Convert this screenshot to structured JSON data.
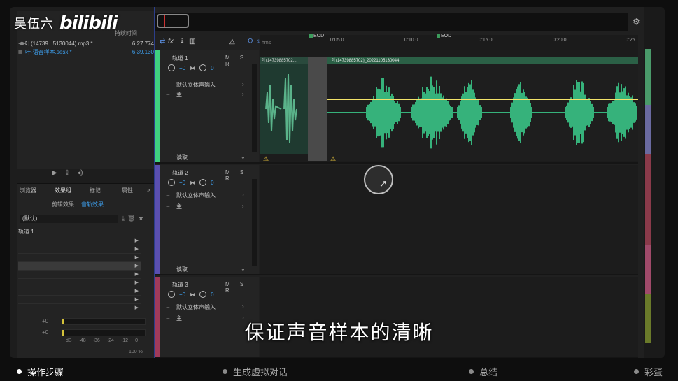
{
  "brand": {
    "author": "吴伍六",
    "logo": "bilibili"
  },
  "files_panel": {
    "duration_header": "持续时间",
    "files": [
      {
        "name": "叶(14739...5130044).mp3 *",
        "duration": "6:27.774"
      },
      {
        "name": "叶-语音样本.sesx *",
        "duration": "6:39.130"
      }
    ]
  },
  "fx_panel": {
    "tabs": [
      "浏览器",
      "效果组",
      "标记",
      "属性"
    ],
    "active_tab": "效果组",
    "subtabs": [
      "剪辑效果",
      "音轨效果"
    ],
    "active_subtab": "音轨效果",
    "preset": "(默认)",
    "track_label": "轨道 1",
    "meter_values": [
      "+0",
      "+0"
    ],
    "db_scale": [
      "dB",
      "-48",
      "-36",
      "-24",
      "-12",
      "0"
    ],
    "mix": "100 %"
  },
  "editor": {
    "ruler": {
      "unit": "hms",
      "ticks": [
        "0:05.0",
        "0:10.0",
        "0:15.0",
        "0:20.0",
        "0:25"
      ],
      "eod_label": "EOD"
    },
    "tracks": [
      {
        "name": "轨道 1",
        "volume": "+0",
        "pan": "0",
        "input": "默认立体声输入",
        "output": "主",
        "automation": "读取",
        "color": "#3fd07f"
      },
      {
        "name": "轨道 2",
        "volume": "+0",
        "pan": "0",
        "input": "默认立体声输入",
        "output": "主",
        "automation": "读取",
        "color": "#5a4fb0"
      },
      {
        "name": "轨道 3",
        "volume": "+0",
        "pan": "0",
        "input": "默认立体声输入",
        "output": "主",
        "automation": "",
        "color": "#a03a5a"
      }
    ],
    "msr": "M S R",
    "clips": [
      {
        "label": "叶(14739885702..."
      },
      {
        "label": "叶(14739885702)_20221105130044"
      }
    ]
  },
  "subtitle": "保证声音样本的清晰",
  "chapters": [
    {
      "label": "操作步骤",
      "active": true
    },
    {
      "label": "生成虚拟对话",
      "active": false
    },
    {
      "label": "总结",
      "active": false
    },
    {
      "label": "彩蛋",
      "active": false
    }
  ],
  "colors": {
    "waveform": "#3fe39a",
    "accent": "#3ea1f0",
    "playhead": "#c73333",
    "volume_envelope": "#f3e36a"
  }
}
